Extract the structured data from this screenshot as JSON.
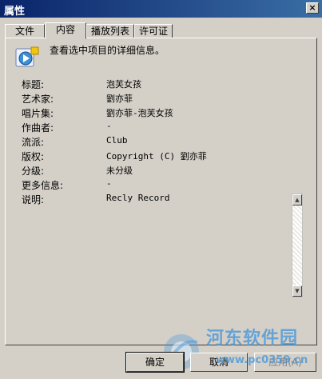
{
  "window": {
    "title": "属性",
    "close_label": "×"
  },
  "tabs": [
    {
      "label": "文件",
      "active": false
    },
    {
      "label": "内容",
      "active": true
    },
    {
      "label": "播放列表",
      "active": false
    },
    {
      "label": "许可证",
      "active": false
    }
  ],
  "content": {
    "description": "查看选中项目的详细信息。",
    "icon": "media-player-icon",
    "properties": [
      {
        "label": "标题:",
        "value": "泡芙女孩"
      },
      {
        "label": "艺术家:",
        "value": "劉亦菲"
      },
      {
        "label": "唱片集:",
        "value": "劉亦菲-泡芙女孩"
      },
      {
        "label": "作曲者:",
        "value": "-"
      },
      {
        "label": "流派:",
        "value": "Club"
      },
      {
        "label": "版权:",
        "value": "Copyright (C) 劉亦菲"
      },
      {
        "label": "分级:",
        "value": "未分级"
      },
      {
        "label": "更多信息:",
        "value": "-"
      },
      {
        "label": "说明:",
        "value": "Recly Record"
      }
    ]
  },
  "buttons": {
    "ok": "确定",
    "cancel": "取消",
    "apply": "应用(A)"
  },
  "watermark": {
    "name": "河东软件园",
    "url": "www.pc0359.cn"
  },
  "colors": {
    "titlebar": "#0a246a",
    "face": "#d4d0c8",
    "watermark": "#4a97d9"
  }
}
